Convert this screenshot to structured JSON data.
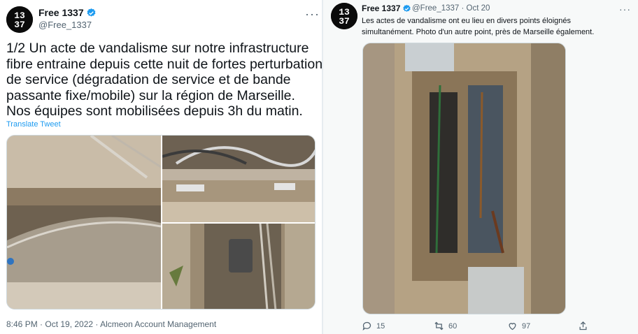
{
  "left_tweet": {
    "author_name": "Free 1337",
    "author_handle": "@Free_1337",
    "avatar_text_top": "13",
    "avatar_text_bottom": "37",
    "text_lines": [
      "1/2 Un acte de vandalisme sur notre infrastructure",
      "fibre entraine depuis cette nuit de fortes perturbations",
      "de service (dégradation de service et de bande",
      "passante fixe/mobile) sur la région de Marseille.",
      "Nos équipes sont mobilisées depuis 3h du matin."
    ],
    "translate_label": "Translate Tweet",
    "timestamp": "8:46 PM · Oct 19, 2022 · Alcmeon Account Management",
    "more_label": "···"
  },
  "right_tweet": {
    "author_name": "Free 1337",
    "author_handle": "@Free_1337 · Oct 20",
    "avatar_text_top": "13",
    "avatar_text_bottom": "37",
    "text_lines": [
      "Les actes de vandalisme ont eu lieu en divers points éloignés",
      "simultanément. Photo d'un autre point, près de Marseille également."
    ],
    "more_label": "···",
    "reply_count": "15",
    "retweet_count": "60",
    "like_count": "97"
  },
  "colors": {
    "link": "#1d9bf0",
    "secondary_text": "#536471",
    "verified_badge": "#1d9bf0"
  }
}
